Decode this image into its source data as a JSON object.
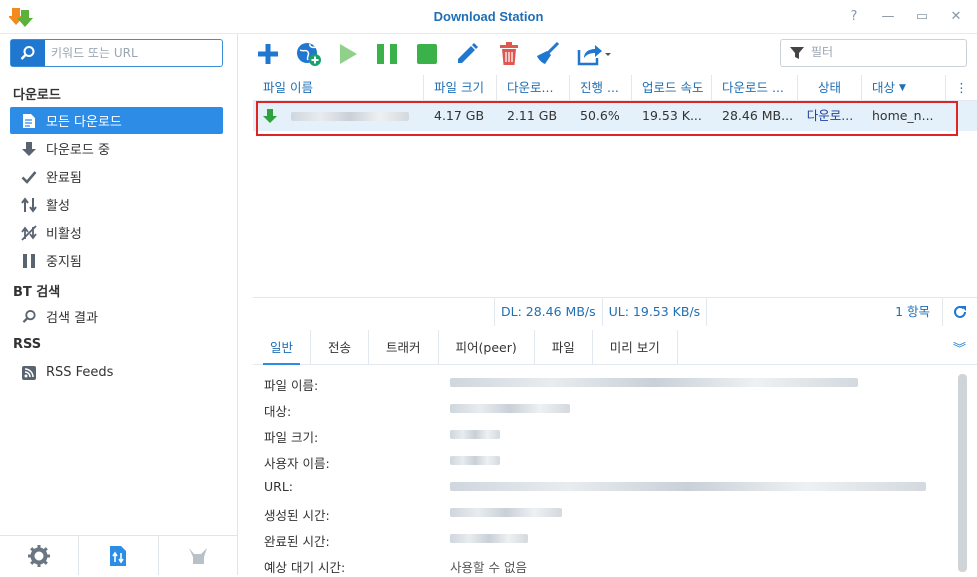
{
  "window": {
    "title": "Download Station",
    "help": "?",
    "minimize": "—",
    "maximize": "▭",
    "close": "✕"
  },
  "sidebar": {
    "search_placeholder": "키워드 또는 URL",
    "section_download": "다운로드",
    "items": [
      {
        "label": "모든 다운로드",
        "icon": "document-icon"
      },
      {
        "label": "다운로드 중",
        "icon": "arrow-down-icon"
      },
      {
        "label": "완료됨",
        "icon": "check-icon"
      },
      {
        "label": "활성",
        "icon": "up-down-arrows-icon"
      },
      {
        "label": "비활성",
        "icon": "inactive-icon"
      },
      {
        "label": "중지됨",
        "icon": "pause-icon"
      }
    ],
    "section_bt": "BT 검색",
    "bt_items": [
      {
        "label": "검색 결과",
        "icon": "search-icon"
      }
    ],
    "section_rss": "RSS",
    "rss_items": [
      {
        "label": "RSS Feeds",
        "icon": "rss-icon"
      }
    ]
  },
  "toolbar": {
    "filter_placeholder": "필터"
  },
  "table": {
    "headers": [
      "파일 이름",
      "파일 크기",
      "다운로...",
      "진행 ...",
      "업로드 속도",
      "다운로드 ...",
      "상태",
      "대상"
    ],
    "rows": [
      {
        "file_size": "4.17 GB",
        "downloaded": "2.11 GB",
        "progress": "50.6%",
        "upload_speed": "19.53 K...",
        "download_speed": "28.46 MB...",
        "status": "다운로...",
        "target": "home_n..."
      }
    ]
  },
  "status": {
    "dl": "DL:  28.46 MB/s",
    "ul": "UL:  19.53 KB/s",
    "count": "1 항목"
  },
  "tabs": [
    "일반",
    "전송",
    "트래커",
    "피어(peer)",
    "파일",
    "미리 보기"
  ],
  "details": {
    "labels": [
      "파일 이름:",
      "대상:",
      "파일 크기:",
      "사용자 이름:",
      "URL:",
      "생성된 시간:",
      "완료된 시간:",
      "예상 대기 시간:"
    ],
    "eta_value": "사용할 수 없음"
  },
  "colors": {
    "accent": "#2d8ce6",
    "title": "#1f6fb5",
    "highlight_border": "#e02424",
    "row_selected": "#e4f1fb"
  }
}
